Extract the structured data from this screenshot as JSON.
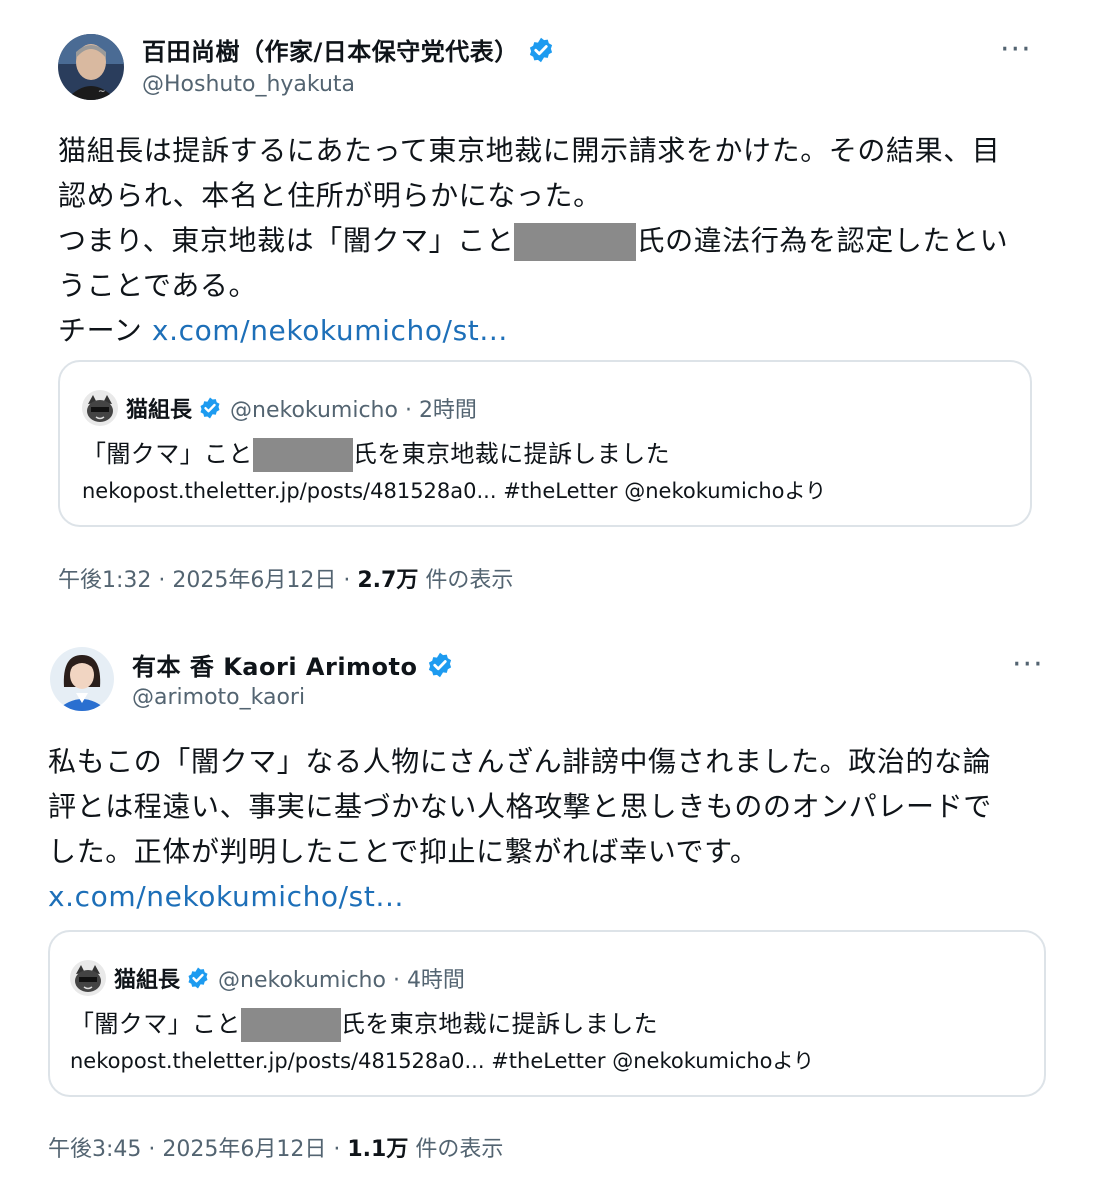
{
  "tweets": [
    {
      "author_name": "百田尚樹（作家/日本保守党代表）",
      "author_handle": "@Hoshuto_hyakuta",
      "more_label": "···",
      "body_lines": [
        "猫組長は提訴するにあたって東京地裁に開示請求をかけた。その結果、目",
        "認められ、本名と住所が明らかになった。"
      ],
      "line3_before": "つまり、東京地裁は「闇クマ」こと",
      "line3_after": "氏の違法行為を認定したとい",
      "line4": "うことである。",
      "line5_prefix": "チーン ",
      "link": "x.com/nekokumicho/st...",
      "quote": {
        "name": "猫組長",
        "handle_time": "@nekokumicho · 2時間",
        "text_before": "「闇クマ」こと",
        "text_after": "氏を東京地裁に提訴しました",
        "url_line": "nekopost.theletter.jp/posts/481528a0... #theLetter @nekokumichoより"
      },
      "time": "午後1:32 · 2025年6月12日 · ",
      "views": "2.7万",
      "views_label": " 件の表示"
    },
    {
      "author_name": "有本 香 Kaori Arimoto",
      "author_handle": "@arimoto_kaori",
      "more_label": "···",
      "body_lines": [
        "私もこの「闇クマ」なる人物にさんざん誹謗中傷されました。政治的な論",
        "評とは程遠い、事実に基づかない人格攻撃と思しきもののオンパレードで",
        "した。正体が判明したことで抑止に繋がれば幸いです。"
      ],
      "link": "x.com/nekokumicho/st...",
      "quote": {
        "name": "猫組長",
        "handle_time": "@nekokumicho · 4時間",
        "text_before": "「闇クマ」こと",
        "text_after": "氏を東京地裁に提訴しました",
        "url_line": "nekopost.theletter.jp/posts/481528a0... #theLetter @nekokumichoより"
      },
      "time": "午後3:45 · 2025年6月12日 · ",
      "views": "1.1万",
      "views_label": " 件の表示"
    }
  ],
  "colors": {
    "verified": "#1d9bf0",
    "link": "#1d6fb8",
    "redaction": "#8a8a8a",
    "secondary_text": "#536471"
  },
  "icons": {
    "verified": "verified-badge-icon",
    "more": "more-options-icon"
  }
}
